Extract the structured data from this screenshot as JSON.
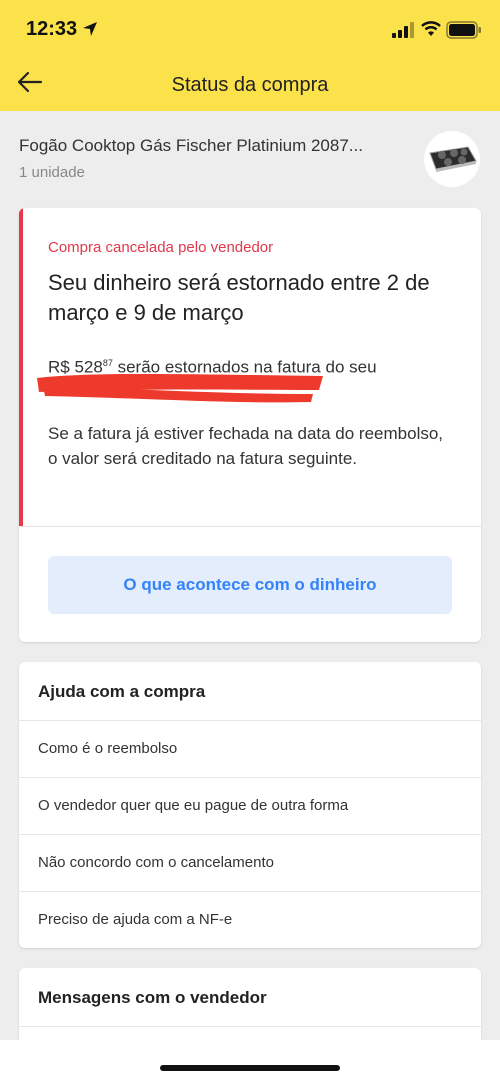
{
  "status_bar": {
    "time": "12:33",
    "icons": [
      "location-arrow-icon",
      "signal-icon",
      "wifi-icon",
      "battery-icon"
    ]
  },
  "nav": {
    "back_icon": "arrow-left-icon",
    "title": "Status da compra"
  },
  "product": {
    "name": "Fogão Cooktop Gás Fischer Platinium 2087...",
    "quantity": "1 unidade",
    "thumb_icon": "cooktop-image"
  },
  "status_card": {
    "status_label": "Compra cancelada pelo vendedor",
    "title": "Seu dinheiro será estornado entre 2 de março e 9 de março",
    "amount_main": "R$ 528",
    "amount_cents": "87",
    "refund_text": "serão estornados na fatura do seu",
    "invoice_text": "Se a fatura já estiver fechada na data do reembolso, o valor será creditado na fatura seguinte.",
    "button_label": "O que acontece com o dinheiro"
  },
  "help_card": {
    "title": "Ajuda com a compra",
    "items": [
      "Como é o reembolso",
      "O vendedor quer que eu pague de outra forma",
      "Não concordo com o cancelamento",
      "Preciso de ajuda com a NF-e"
    ]
  },
  "messages_card": {
    "title": "Mensagens com o vendedor"
  },
  "colors": {
    "header_yellow": "#fbe14a",
    "cancel_red": "#e8364a",
    "link_blue": "#3483fa",
    "button_bg": "#e3edfb",
    "redaction_red": "#ee3a2d"
  }
}
